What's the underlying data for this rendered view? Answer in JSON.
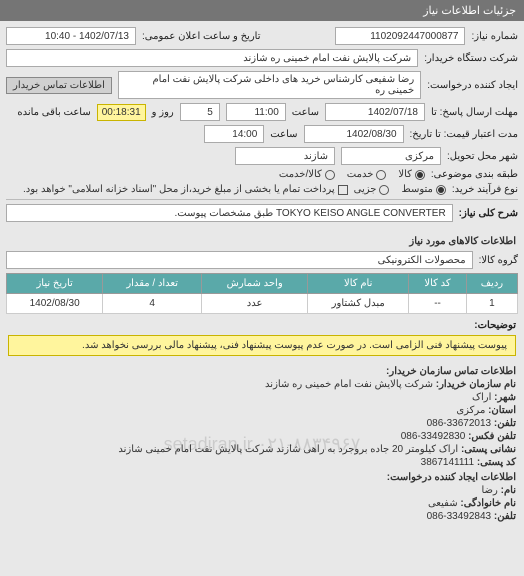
{
  "header": {
    "title": "جزئیات اطلاعات نیاز"
  },
  "need_number": {
    "label": "شماره نیاز:",
    "value": "1102092447000877"
  },
  "announce": {
    "label": "تاریخ و ساعت اعلان عمومی:",
    "value": "1402/07/13 - 10:40"
  },
  "buyer": {
    "label": "شرکت دستگاه خریدار:",
    "value": "شرکت پالایش نفت امام خمینی ره شازند"
  },
  "creator": {
    "label": "ایجاد کننده درخواست:",
    "value": "رضا  شفیعی  کارشناس خرید های داخلی  شرکت پالایش نفت امام خمینی ره"
  },
  "contact_button": "اطلاعات تماس خریدار",
  "deadline": {
    "label": "مهلت ارسال پاسخ: تا",
    "date": "1402/07/18",
    "time_label": "ساعت",
    "time": "11:00",
    "days": "5",
    "day_label": "روز و",
    "remain": "00:18:31",
    "remain_label": "ساعت باقی مانده"
  },
  "valid_until": {
    "label": "مدت اعتبار قیمت: تا تاریخ:",
    "date": "1402/08/30",
    "time_label": "ساعت",
    "time": "14:00"
  },
  "delivery_city": {
    "label": "شهر محل تحویل:",
    "prov": "مرکزی",
    "city": "شازند"
  },
  "category": {
    "label": "طبقه بندی موضوعی:",
    "goods": "کالا",
    "service": "خدمت",
    "both": "کالا/خدمت",
    "selected": "goods"
  },
  "purchase_type": {
    "label": "نوع فرآیند خرید:",
    "medium": "متوسط",
    "minor": "جزیی",
    "selected": "medium",
    "note_checkbox": "پرداخت تمام یا بخشی از مبلغ خرید،از محل \"اسناد خزانه اسلامی\" خواهد بود."
  },
  "description": {
    "label": "شرح کلی نیاز:",
    "value": "TOKYO KEISO ANGLE CONVERTER طبق مشخصات پیوست."
  },
  "items_section": "اطلاعات کالاهای مورد نیاز",
  "goods_group": {
    "label": "گروه کالا:",
    "value": "محصولات الکترونیکی"
  },
  "table": {
    "headers": [
      "ردیف",
      "کد کالا",
      "نام کالا",
      "واحد شمارش",
      "تعداد / مقدار",
      "تاریخ نیاز"
    ],
    "rows": [
      [
        "1",
        "--",
        "مبدل کشتاور",
        "عدد",
        "4",
        "1402/08/30"
      ]
    ]
  },
  "notes_label": "توضیحات:",
  "yellow_note": "پیوست پیشنهاد فنی الزامی است. در صورت عدم پیوست پیشنهاد فنی، پیشنهاد مالی بررسی نخواهد شد.",
  "contact_section": "اطلاعات تماس سازمان خریدار:",
  "org": {
    "name_label": "نام سازمان خریدار:",
    "name": "شرکت پالایش نفت امام خمینی ره شازند",
    "city_label": "شهر:",
    "city": "اراک",
    "prov_label": "استان:",
    "prov": "مرکزی",
    "phone_label": "تلفن:",
    "phone": "33672013-086",
    "fax_label": "تلفن فکس:",
    "fax": "33492830-086",
    "postal_label": "نشانی پستی:",
    "postal": "اراک کیلومتر 20 جاده بروجرد به راهی شازند شرکت پالایش نفت امام خمینی شازند",
    "postcode_label": "کد پستی:",
    "postcode": "3867141111"
  },
  "creator_section": "اطلاعات ایجاد کننده درخواست:",
  "creator_info": {
    "name_label": "نام:",
    "name": "رضا",
    "family_label": "نام خانوادگی:",
    "family": "شفیعی",
    "phone_label": "تلفن:",
    "phone": "33492843-086"
  },
  "watermark": "setadiran.ir\n۰۲۱-۸۸۳۴۹۶۷"
}
